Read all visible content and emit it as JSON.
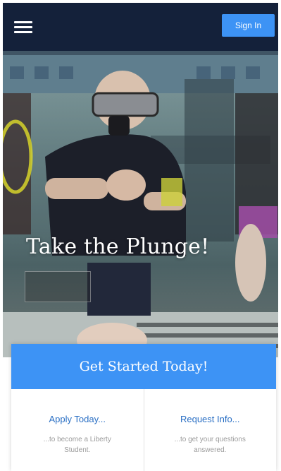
{
  "header": {
    "signin_label": "Sign In"
  },
  "hero": {
    "title": "Take the Plunge!"
  },
  "card": {
    "title": "Get Started Today!",
    "options": [
      {
        "link": "Apply Today...",
        "description": "...to become a Liberty Student."
      },
      {
        "link": "Request Info...",
        "description": "...to get your questions answered."
      }
    ]
  },
  "colors": {
    "header_bg": "#14213a",
    "accent": "#3d93f5",
    "link": "#2a6fc4"
  }
}
